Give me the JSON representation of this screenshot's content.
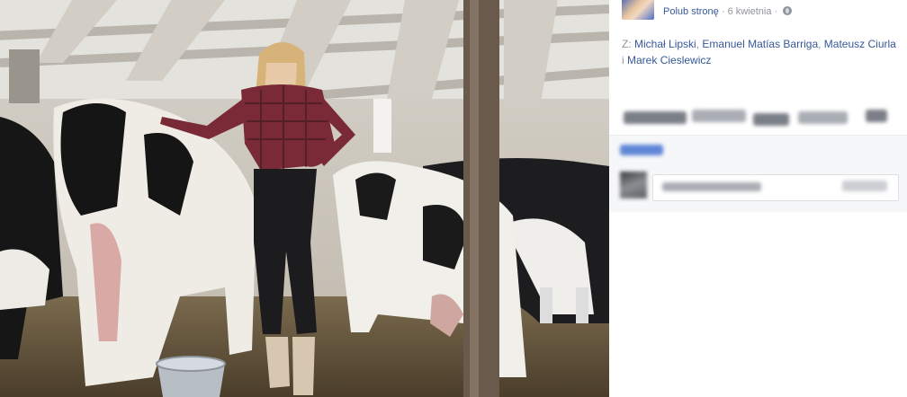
{
  "post": {
    "like_page_label": "Polub stronę",
    "separator": "·",
    "date": "6 kwietnia",
    "privacy_icon": "globe-icon",
    "tags_prefix": "Z:",
    "tagged": [
      "Michał Lipski",
      "Emanuel Matías Barriga",
      "Mateusz Ciurla",
      "Marek Cieslewicz"
    ],
    "conjunction": "i"
  },
  "colors": {
    "link": "#365899",
    "meta_gray": "#90949c",
    "comment_bg": "#f6f7f9"
  }
}
